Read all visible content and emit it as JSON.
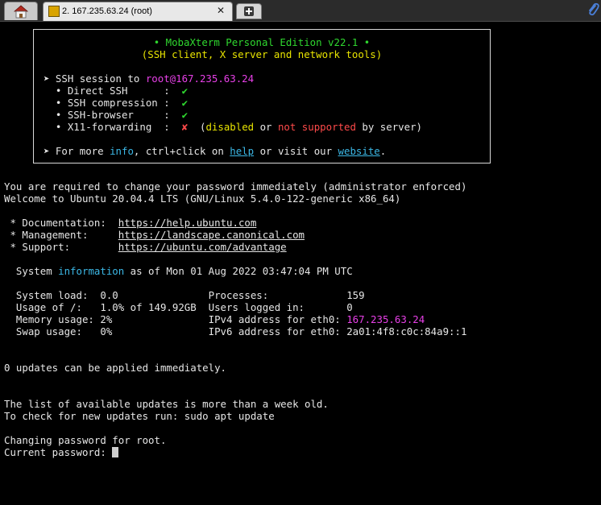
{
  "tabs": {
    "session_label": "2. 167.235.63.24 (root)",
    "close_glyph": "✕"
  },
  "banner": {
    "title": "• MobaXterm Personal Edition v22.1 •",
    "subtitle": "(SSH client, X server and network tools)",
    "ssh_prefix": "➤ SSH session to ",
    "ssh_target": "root@167.235.63.24",
    "features": [
      {
        "label": "  • Direct SSH      :  ",
        "mark": "✔"
      },
      {
        "label": "  • SSH compression :  ",
        "mark": "✔"
      },
      {
        "label": "  • SSH-browser     :  ",
        "mark": "✔"
      },
      {
        "label": "  • X11-forwarding  :  ",
        "mark": "✘"
      }
    ],
    "x11_open": "  (",
    "x11_disabled": "disabled",
    "x11_or": " or ",
    "x11_not_supported": "not supported",
    "x11_tail": " by server)",
    "more_prefix": "➤ For more ",
    "more_info": "info",
    "more_mid": ", ctrl+click on ",
    "more_help": "help",
    "more_mid2": " or visit our ",
    "more_website": "website",
    "more_end": "."
  },
  "motd": {
    "line_change_required": "You are required to change your password immediately (administrator enforced)",
    "line_welcome": "Welcome to Ubuntu 20.04.4 LTS (GNU/Linux 5.4.0-122-generic x86_64)",
    "doc_label": " * Documentation:  ",
    "doc_url": "https://help.ubuntu.com",
    "mgmt_label": " * Management:     ",
    "mgmt_url": "https://landscape.canonical.com",
    "support_label": " * Support:        ",
    "support_url": "https://ubuntu.com/advantage",
    "sysinfo_prefix": "  System ",
    "sysinfo_word": "information",
    "sysinfo_suffix": " as of Mon 01 Aug 2022 03:47:04 PM UTC",
    "stats_row1": "  System load:  0.0               Processes:             159",
    "stats_row2": "  Usage of /:   1.0% of 149.92GB  Users logged in:       0",
    "stats_row3_prefix": "  Memory usage: 2%                IPv4 address for eth0: ",
    "stats_row3_ip": "167.235.63.24",
    "stats_row4": "  Swap usage:   0%                IPv6 address for eth0: 2a01:4f8:c0c:84a9::1",
    "line_updates": "0 updates can be applied immediately.",
    "line_old": "The list of available updates is more than a week old.",
    "line_check": "To check for new updates run: sudo apt update",
    "line_changing": "Changing password for root.",
    "line_prompt": "Current password: "
  }
}
